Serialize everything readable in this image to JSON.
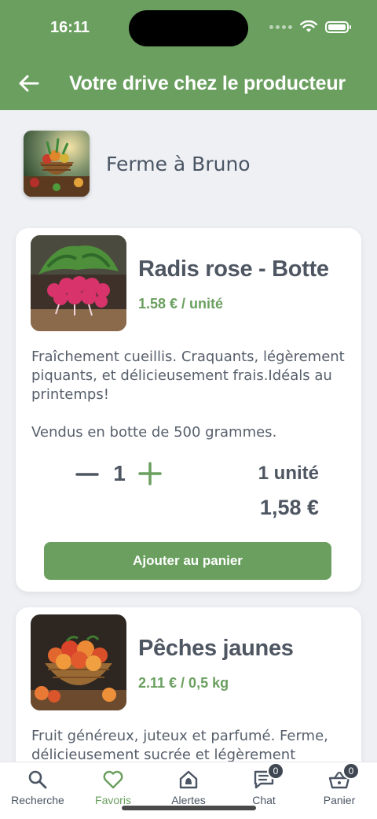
{
  "status_bar": {
    "time": "16:11"
  },
  "header": {
    "title": "Votre drive chez le producteur",
    "accent": "#6a9f5f"
  },
  "farm": {
    "name": "Ferme à Bruno"
  },
  "products": [
    {
      "name": "Radis rose - Botte",
      "price": "1.58 € / unité",
      "description": [
        "Fraîchement cueillis. Craquants, légèrement piquants, et délicieusement frais.Idéals au printemps!",
        "Vendus en botte de 500 grammes."
      ],
      "quantity": "1",
      "unit_summary": "1 unité",
      "total": "1,58 €",
      "add_label": "Ajouter au panier"
    },
    {
      "name": "Pêches jaunes",
      "price": "2.11 € / 0,5 kg",
      "description": [
        "Fruit généreux, juteux et parfumé. Ferme, délicieusement sucrée et légèrement"
      ]
    }
  ],
  "tabbar": {
    "items": [
      {
        "label": "Recherche",
        "icon": "search-icon"
      },
      {
        "label": "Favoris",
        "icon": "heart-icon"
      },
      {
        "label": "Alertes",
        "icon": "bell-house-icon"
      },
      {
        "label": "Chat",
        "icon": "chat-icon",
        "badge": "0"
      },
      {
        "label": "Panier",
        "icon": "basket-icon",
        "badge": "0"
      }
    ]
  }
}
